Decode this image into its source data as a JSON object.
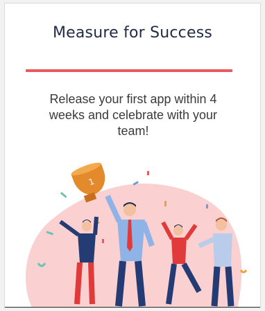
{
  "card": {
    "title": "Measure for Success",
    "body": "Release your first app within 4 weeks and celebrate with your team!"
  },
  "illustration": {
    "name": "team-celebration-illustration",
    "trophy_number": "1"
  },
  "colors": {
    "accent": "#e85a5f",
    "blob": "#fbd0d0",
    "trophy": "#e38a2d",
    "navy": "#243b73",
    "red": "#e03a3a",
    "lightblue": "#8fb3e6"
  }
}
